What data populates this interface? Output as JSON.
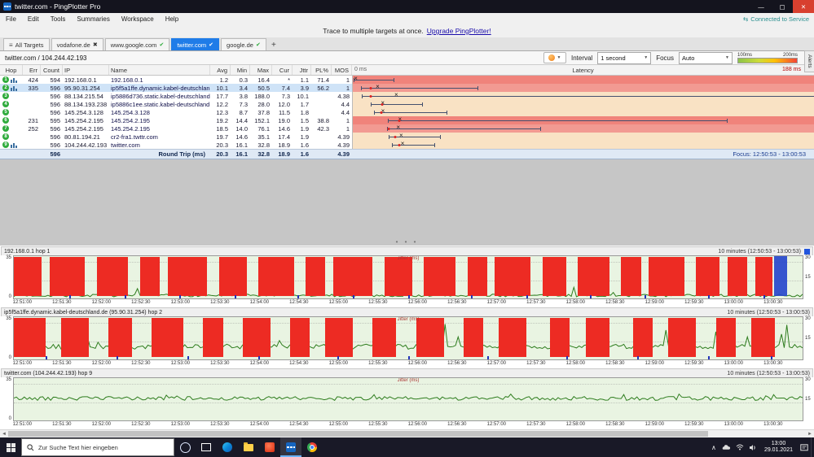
{
  "window": {
    "title": "twitter.com - PingPlotter Pro",
    "menu": [
      "File",
      "Edit",
      "Tools",
      "Summaries",
      "Workspace",
      "Help"
    ],
    "promo_text": "Trace to multiple targets at once.",
    "promo_link": "Upgrade PingPlotter!",
    "connection_status": "Connected to Service",
    "controls": {
      "minimize": "—",
      "maximize": "▢",
      "close": "✕"
    }
  },
  "tabs": {
    "all_targets": "All Targets",
    "add_label": "+",
    "alerts_label": "Alerts",
    "items": [
      {
        "label": "vodafone.de",
        "state": "err",
        "active": false
      },
      {
        "label": "www.google.com",
        "state": "ok",
        "active": false
      },
      {
        "label": "twitter.com",
        "state": "ok",
        "active": true
      },
      {
        "label": "google.de",
        "state": "ok",
        "active": false
      }
    ]
  },
  "target": {
    "title": "twitter.com / 104.244.42.193",
    "interval_label": "Interval",
    "interval_value": "1 second",
    "focus_label": "Focus",
    "focus_value": "Auto",
    "legend_low": "100ms",
    "legend_high": "200ms"
  },
  "table": {
    "headers": [
      "Hop",
      "Err",
      "Count",
      "IP",
      "Name",
      "Avg",
      "Min",
      "Max",
      "Cur",
      "Jttr",
      "PL%",
      "MOS"
    ],
    "latency_header": {
      "left": "0 ms",
      "center": "Latency",
      "right": "188 ms"
    },
    "latency_scale_max": 188,
    "rows": [
      {
        "hop": "1",
        "err": "424",
        "count": "594",
        "ip": "192.168.0.1",
        "name": "192.168.0.1",
        "avg": "1.2",
        "min": "0.3",
        "max": "16.4",
        "cur": "*",
        "jttr": "1.1",
        "pl": "71.4",
        "mos": "1",
        "chart_icon": true,
        "lat_bg": "red1",
        "selected": false
      },
      {
        "hop": "2",
        "err": "335",
        "count": "596",
        "ip": "95.90.31.254",
        "name": "ip5f5a1ffe.dynamic.kabel-deutschland.de",
        "avg": "10.1",
        "min": "3.4",
        "max": "50.5",
        "cur": "7.4",
        "jttr": "3.9",
        "pl": "56.2",
        "mos": "1",
        "chart_icon": true,
        "lat_bg": "red2",
        "selected": true
      },
      {
        "hop": "3",
        "err": "",
        "count": "596",
        "ip": "88.134.215.54",
        "name": "ip5886d736.static.kabel-deutschland.de",
        "avg": "17.7",
        "min": "3.8",
        "max": "188.0",
        "cur": "7.3",
        "jttr": "10.1",
        "pl": "",
        "mos": "4.38",
        "chart_icon": false,
        "lat_bg": "peach",
        "selected": false
      },
      {
        "hop": "4",
        "err": "",
        "count": "596",
        "ip": "88.134.193.238",
        "name": "ip5886c1ee.static.kabel-deutschland.de",
        "avg": "12.2",
        "min": "7.3",
        "max": "28.0",
        "cur": "12.0",
        "jttr": "1.7",
        "pl": "",
        "mos": "4.4",
        "chart_icon": false,
        "lat_bg": "peach",
        "selected": false
      },
      {
        "hop": "5",
        "err": "",
        "count": "596",
        "ip": "145.254.3.128",
        "name": "145.254.3.128",
        "avg": "12.3",
        "min": "8.7",
        "max": "37.8",
        "cur": "11.5",
        "jttr": "1.8",
        "pl": "",
        "mos": "4.4",
        "chart_icon": false,
        "lat_bg": "peach",
        "selected": false
      },
      {
        "hop": "6",
        "err": "231",
        "count": "595",
        "ip": "145.254.2.195",
        "name": "145.254.2.195",
        "avg": "19.2",
        "min": "14.4",
        "max": "152.1",
        "cur": "19.0",
        "jttr": "1.5",
        "pl": "38.8",
        "mos": "1",
        "chart_icon": false,
        "lat_bg": "red1",
        "selected": false
      },
      {
        "hop": "7",
        "err": "252",
        "count": "596",
        "ip": "145.254.2.195",
        "name": "145.254.2.195",
        "avg": "18.5",
        "min": "14.0",
        "max": "76.1",
        "cur": "14.6",
        "jttr": "1.9",
        "pl": "42.3",
        "mos": "1",
        "chart_icon": false,
        "lat_bg": "red2",
        "selected": false
      },
      {
        "hop": "8",
        "err": "",
        "count": "596",
        "ip": "80.81.194.21",
        "name": "cr2-fra1.twttr.com",
        "avg": "19.7",
        "min": "14.6",
        "max": "35.1",
        "cur": "17.4",
        "jttr": "1.9",
        "pl": "",
        "mos": "4.39",
        "chart_icon": false,
        "lat_bg": "peach",
        "selected": false
      },
      {
        "hop": "9",
        "err": "",
        "count": "596",
        "ip": "104.244.42.193",
        "name": "twitter.com",
        "avg": "20.3",
        "min": "16.1",
        "max": "32.8",
        "cur": "18.9",
        "jttr": "1.6",
        "pl": "",
        "mos": "4.39",
        "chart_icon": true,
        "lat_bg": "peach",
        "selected": false
      }
    ],
    "footer": {
      "count": "596",
      "label": "Round Trip (ms)",
      "avg": "20.3",
      "min": "16.1",
      "max": "32.8",
      "cur": "18.9",
      "jttr": "1.6",
      "mos": "4.39",
      "focus_note": "Focus: 12:50:53 - 13:00:53"
    }
  },
  "graphs": {
    "jitter_label": "Jitter (ms)",
    "left_ticks": [
      "35",
      "0"
    ],
    "right_ticks": [
      "30",
      "15"
    ],
    "x_labels": [
      "12:51:00",
      "12:51:30",
      "12:52:00",
      "12:52:30",
      "12:53:00",
      "12:53:30",
      "12:54:00",
      "12:54:30",
      "12:55:00",
      "12:55:30",
      "12:56:00",
      "12:56:30",
      "12:57:00",
      "12:57:30",
      "12:58:00",
      "12:58:30",
      "12:59:00",
      "12:59:30",
      "13:00:00",
      "13:00:30"
    ],
    "items": [
      {
        "label": "192.168.0.1 hop 1",
        "range": "10 minutes (12:50:53 - 13:00:53)",
        "seed": 7,
        "baseline": 0.07,
        "amp": 0.06,
        "spike": 0.25,
        "selection": true,
        "red_segments": [
          [
            0,
            3.5
          ],
          [
            4.5,
            4.5
          ],
          [
            10.5,
            4
          ],
          [
            16,
            2.5
          ],
          [
            19.5,
            5
          ],
          [
            26,
            3.5
          ],
          [
            31,
            4.5
          ],
          [
            37,
            2.5
          ],
          [
            40.5,
            5
          ],
          [
            47,
            3.5
          ],
          [
            52,
            4
          ],
          [
            57.5,
            2.5
          ],
          [
            61,
            4.5
          ],
          [
            67,
            3
          ],
          [
            71.5,
            4
          ],
          [
            77,
            2.5
          ],
          [
            80.5,
            4.5
          ],
          [
            86.5,
            3
          ],
          [
            90.5,
            2.5
          ],
          [
            94,
            2.2
          ]
        ],
        "blue_ticks": [
          7,
          14,
          21,
          28,
          36,
          43,
          50,
          58,
          65,
          73,
          80,
          88,
          95
        ]
      },
      {
        "label": "ip5f5a1ffe.dynamic.kabel-deutschland.de (95.90.31.254) hop 2",
        "range": "10 minutes (12:50:53 - 13:00:53)",
        "seed": 19,
        "baseline": 0.3,
        "amp": 0.12,
        "spike": 0.55,
        "selection": false,
        "red_segments": [
          [
            0,
            4
          ],
          [
            6,
            3.5
          ],
          [
            12,
            3
          ],
          [
            17.5,
            4
          ],
          [
            24,
            2.5
          ],
          [
            29,
            3.5
          ],
          [
            35,
            2.5
          ],
          [
            39.5,
            3.5
          ],
          [
            45.5,
            3
          ],
          [
            51,
            3.5
          ],
          [
            57,
            2.5
          ],
          [
            61.5,
            3.5
          ],
          [
            68,
            2.5
          ],
          [
            72.5,
            3
          ],
          [
            78.5,
            2.5
          ],
          [
            83,
            3.5
          ],
          [
            89,
            2.5
          ],
          [
            93.5,
            3
          ]
        ],
        "blue_ticks": [
          4,
          13,
          22,
          31,
          41,
          50,
          60,
          70,
          79,
          88,
          96
        ]
      },
      {
        "label": "twitter.com (104.244.42.193) hop 9",
        "range": "10 minutes (12:50:53 - 13:00:53)",
        "seed": 42,
        "baseline": 0.52,
        "amp": 0.09,
        "spike": 0.12,
        "selection": false,
        "red_segments": [],
        "blue_ticks": []
      }
    ]
  },
  "taskbar": {
    "search_placeholder": "Zur Suche Text hier eingeben",
    "time": "13:00",
    "date": "29.01.2021"
  }
}
